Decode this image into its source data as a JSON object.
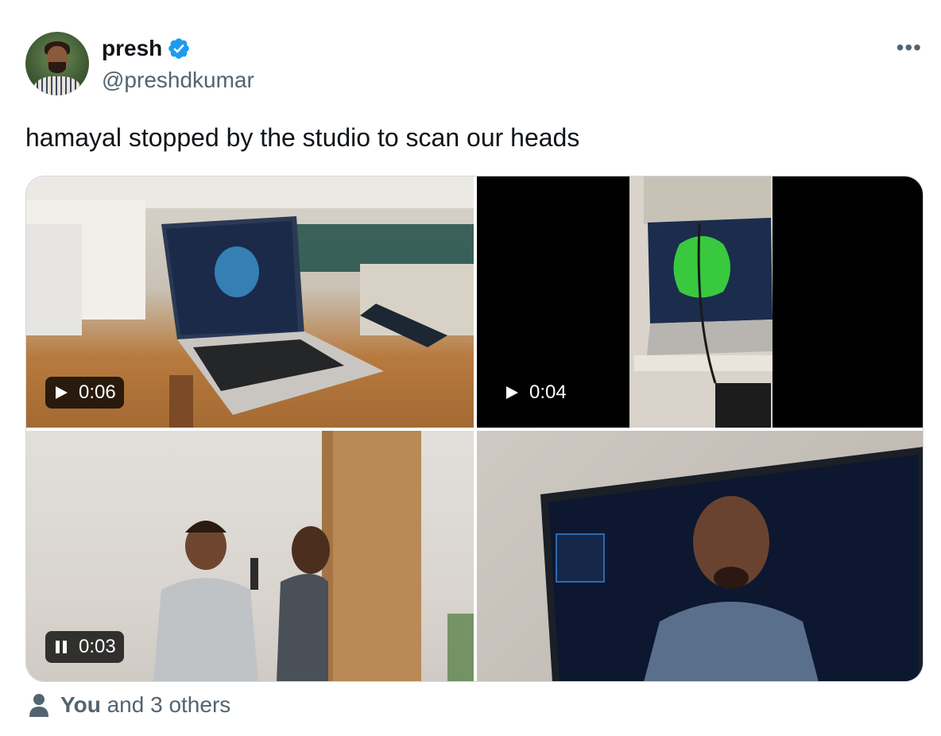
{
  "author": {
    "display_name": "presh",
    "handle": "@preshdkumar",
    "verified_icon": "verified-badge-icon",
    "avatar_icon": "avatar"
  },
  "more_icon": "more-options-icon",
  "tweet": {
    "text": "hamayal stopped by the studio to scan our heads"
  },
  "media": [
    {
      "type": "video",
      "state": "play",
      "icon": "play-icon",
      "duration": "0:06",
      "scene": "laptop-scan-software"
    },
    {
      "type": "video",
      "state": "play",
      "icon": "play-icon",
      "duration": "0:04",
      "scene": "green-scan-on-laptop"
    },
    {
      "type": "video",
      "state": "pause",
      "icon": "pause-icon",
      "duration": "0:03",
      "scene": "two-men-scanning"
    },
    {
      "type": "image",
      "scene": "face-scan-on-screen"
    }
  ],
  "footer": {
    "icon": "person-icon",
    "you_label": "You",
    "others_label": "and 3 others"
  },
  "colors": {
    "verified_blue": "#1d9bf0",
    "secondary_text": "#536471",
    "border": "#cfd9de"
  }
}
